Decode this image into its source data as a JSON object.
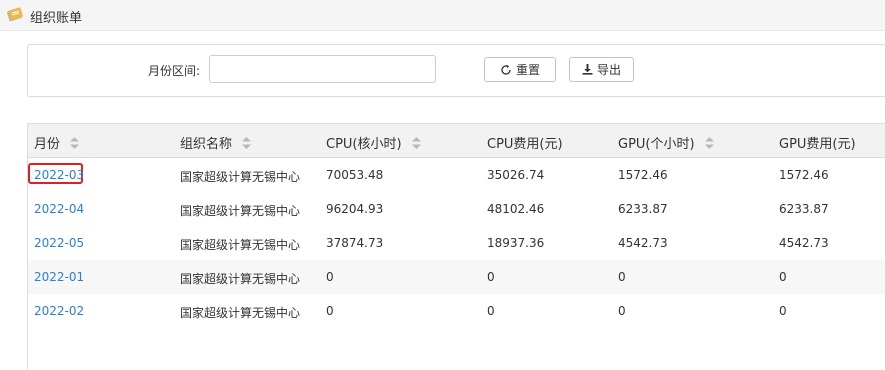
{
  "header": {
    "title": "组织账单",
    "icon": "ledger-icon"
  },
  "filter": {
    "month_label": "月份区间:",
    "month_value": "",
    "reset_label": "重置",
    "export_label": "导出"
  },
  "table": {
    "headers": [
      "月份",
      "组织名称",
      "CPU(核小时)",
      "CPU费用(元)",
      "GPU(个小时)",
      "GPU费用(元)"
    ],
    "rows": [
      [
        "2022-03",
        "国家超级计算无锡中心",
        "70053.48",
        "35026.74",
        "1572.46",
        "1572.46"
      ],
      [
        "2022-04",
        "国家超级计算无锡中心",
        "96204.93",
        "48102.46",
        "6233.87",
        "6233.87"
      ],
      [
        "2022-05",
        "国家超级计算无锡中心",
        "37874.73",
        "18937.36",
        "4542.73",
        "4542.73"
      ],
      [
        "2022-01",
        "国家超级计算无锡中心",
        "0",
        "0",
        "0",
        "0"
      ],
      [
        "2022-02",
        "国家超级计算无锡中心",
        "0",
        "0",
        "0",
        "0"
      ]
    ]
  },
  "colors": {
    "link": "#2d7fd2",
    "highlight": "#e02020",
    "header_bg": "#f2f2f2",
    "alt_row_bg": "#f7f7f7"
  }
}
